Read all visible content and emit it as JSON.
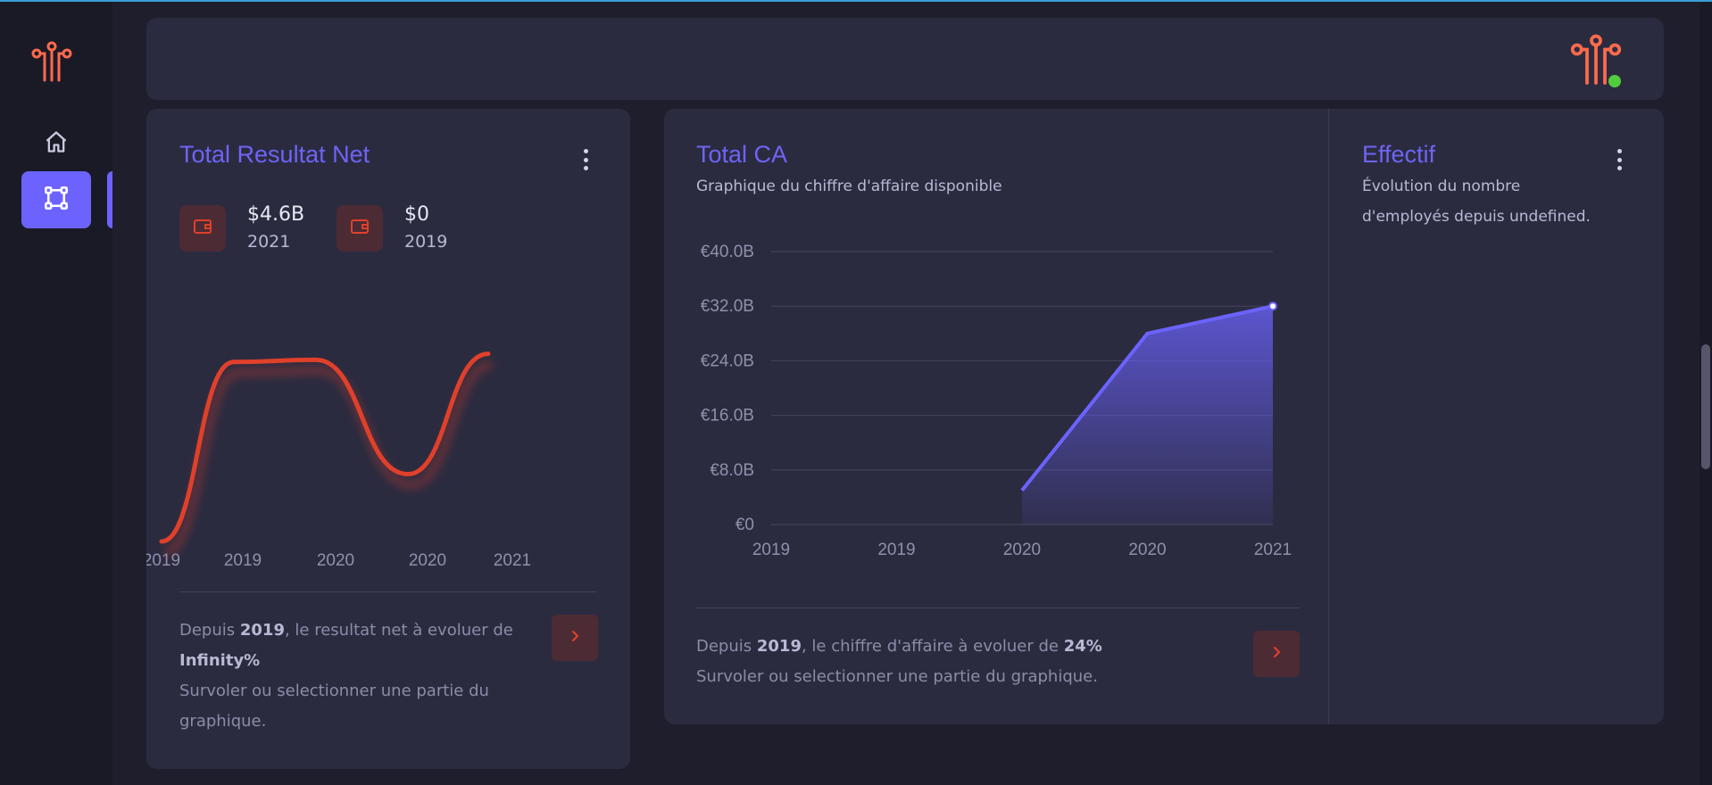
{
  "colors": {
    "accent": "#6c63ff",
    "danger": "#e0402a",
    "background": "#1e1e2d",
    "card": "#2b2b40",
    "online": "#50cd3c"
  },
  "sidebar": {
    "logo_icon": "circuit-logo-icon",
    "items": [
      {
        "icon": "home-icon",
        "active": false
      },
      {
        "icon": "nodes-icon",
        "active": true
      }
    ]
  },
  "header": {
    "avatar_icon": "circuit-logo-icon",
    "status": "online"
  },
  "resultat_net": {
    "title": "Total Resultat Net",
    "stats": [
      {
        "icon": "wallet-icon",
        "value": "$4.6B",
        "year": "2021"
      },
      {
        "icon": "wallet-icon",
        "value": "$0",
        "year": "2019"
      }
    ],
    "footer": {
      "prefix": "Depuis ",
      "year": "2019",
      "middle": ", le resultat net à evoluer de ",
      "change": "Infinity%",
      "hint": "Survoler ou selectionner une partie du graphique."
    }
  },
  "total_ca": {
    "title": "Total CA",
    "subtitle": "Graphique du chiffre d'affaire disponible",
    "footer": {
      "prefix": "Depuis ",
      "year": "2019",
      "middle": ", le chiffre d'affaire à evoluer de ",
      "change": "24%",
      "hint": "Survoler ou selectionner une partie du graphique."
    }
  },
  "effectif": {
    "title": "Effectif",
    "subtitle_line1": "Évolution du nombre",
    "subtitle_line2": "d'employés depuis undefined."
  },
  "chart_data": [
    {
      "type": "line",
      "chart": "resultat_net",
      "x": [
        "2019",
        "2019",
        "2020",
        "2020",
        "2021"
      ],
      "x_tick_labels": [
        "2019",
        "2019",
        "2020",
        "2020",
        "2021"
      ],
      "series": [
        {
          "color": "#e0402a",
          "values": [
            0,
            4.4,
            4.45,
            1.65,
            4.6
          ]
        }
      ],
      "y_unit": "$B",
      "curve": "smooth",
      "grid": false
    },
    {
      "type": "area",
      "chart": "total_ca",
      "x": [
        "2019",
        "2019",
        "2020",
        "2020",
        "2021"
      ],
      "y_tick_labels": [
        "€0",
        "€8.0B",
        "€16.0B",
        "€24.0B",
        "€32.0B",
        "€40.0B"
      ],
      "ylim": [
        0,
        40
      ],
      "y_unit": "€B",
      "series": [
        {
          "color": "#6c63ff",
          "values": [
            null,
            null,
            5,
            28,
            32
          ]
        }
      ],
      "grid": true
    }
  ]
}
